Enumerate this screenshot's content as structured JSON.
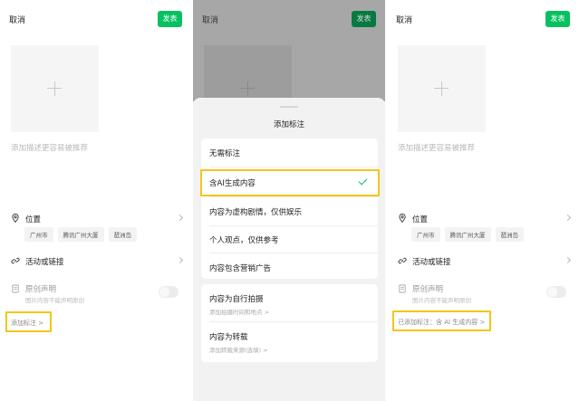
{
  "screen1": {
    "cancel": "取消",
    "publish": "发表",
    "desc_placeholder": "添加描述更容易被推荐",
    "location_label": "位置",
    "location_tags": [
      "广州市",
      "腾讯广州大厦",
      "琶洲岛"
    ],
    "activity_label": "活动或链接",
    "original_label": "原创声明",
    "original_sub": "图片内容不能声明原创",
    "annotation_link": "添加标注 >"
  },
  "screen2": {
    "cancel": "取消",
    "publish": "发表",
    "sheet_title": "添加标注",
    "group1": [
      "无需标注",
      "含AI生成内容",
      "内容为虚构剧情，仅供娱乐",
      "个人观点，仅供参考",
      "内容包含营销广告"
    ],
    "selected_index": 1,
    "group2": [
      {
        "label": "内容为自行拍摄",
        "sub": "添加拍摄时间和地点 >"
      },
      {
        "label": "内容为转载",
        "sub": "添加转载来源(选填) >"
      }
    ]
  },
  "screen3": {
    "cancel": "取消",
    "publish": "发表",
    "desc_placeholder": "添加描述更容易被推荐",
    "location_label": "位置",
    "location_tags": [
      "广州市",
      "腾讯广州大厦",
      "琶洲岛"
    ],
    "activity_label": "活动或链接",
    "original_label": "原创声明",
    "original_sub": "图片内容不能声明原创",
    "annotation_added": "已添加标注：含 AI 生成内容 >"
  },
  "colors": {
    "brand_green": "#07c160",
    "highlight_yellow": "#f5c518"
  }
}
